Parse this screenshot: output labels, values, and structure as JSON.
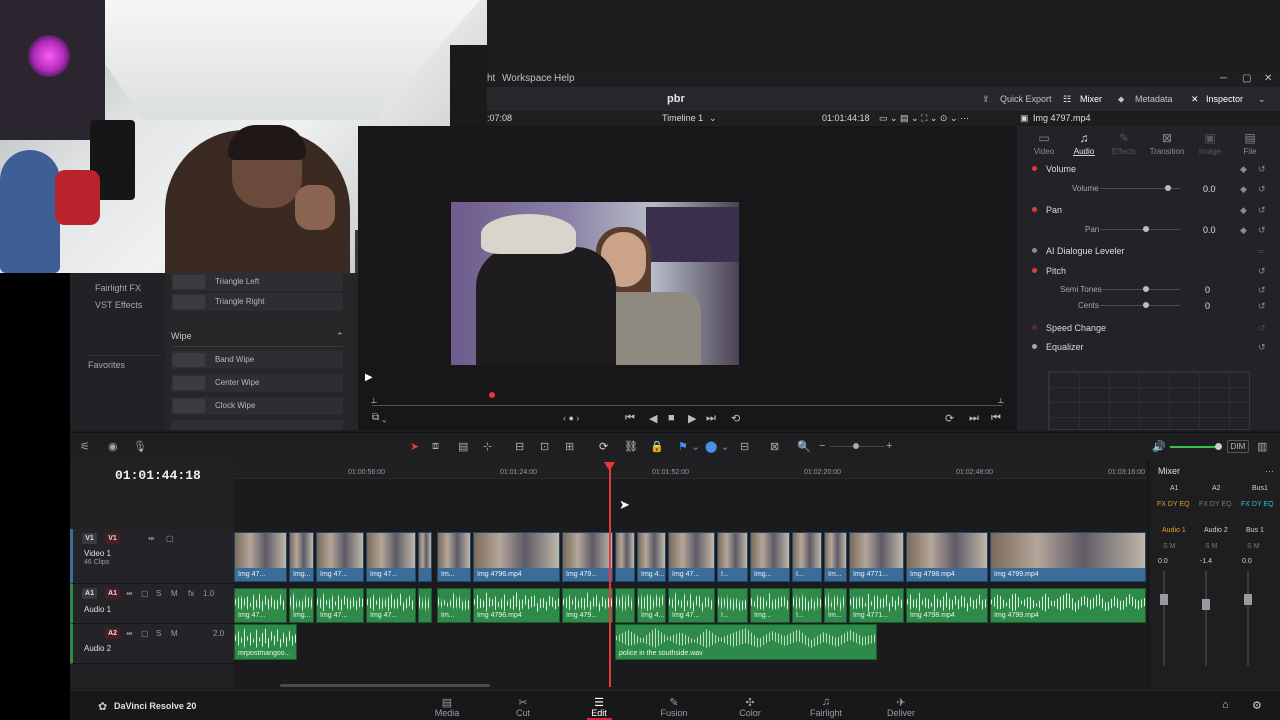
{
  "menubar": {
    "items": [
      "ht",
      "Workspace",
      "Help"
    ]
  },
  "header": {
    "project_title": "pbr",
    "quick_export": "Quick Export",
    "mixer": "Mixer",
    "metadata": "Metadata",
    "inspector": "Inspector",
    "clip_name": "Img 4797.mp4"
  },
  "viewer": {
    "timecode_left": ":07:08",
    "timeline_name": "Timeline 1",
    "timecode_right": "01:01:44:18"
  },
  "effects_library": {
    "categories": [
      "Fairlight FX",
      "VST Effects",
      "Favorites"
    ],
    "items_top": [
      "Triangle Left",
      "Triangle Right"
    ],
    "section": "Wipe",
    "wipe_items": [
      "Band Wipe",
      "Center Wipe",
      "Clock Wipe"
    ]
  },
  "inspector": {
    "tabs": [
      {
        "label": "Video",
        "icon": "video-icon",
        "state": "normal"
      },
      {
        "label": "Audio",
        "icon": "music-note-icon",
        "state": "active"
      },
      {
        "label": "Effects",
        "icon": "effects-icon",
        "state": "disabled"
      },
      {
        "label": "Transition",
        "icon": "transition-icon",
        "state": "normal"
      },
      {
        "label": "Image",
        "icon": "image-icon",
        "state": "disabled"
      },
      {
        "label": "File",
        "icon": "file-icon",
        "state": "normal"
      }
    ],
    "volume": {
      "title": "Volume",
      "param": "Volume",
      "value": "0.0"
    },
    "pan": {
      "title": "Pan",
      "param": "Pan",
      "value": "0.0"
    },
    "dialogue": {
      "title": "AI Dialogue Leveler"
    },
    "pitch": {
      "title": "Pitch",
      "semi_label": "Semi Tones",
      "semi_value": "0",
      "cents_label": "Cents",
      "cents_value": "0"
    },
    "speed_change": {
      "title": "Speed Change"
    },
    "equalizer": {
      "title": "Equalizer"
    },
    "accent_color": "#e23a3a"
  },
  "toolbar": {
    "dim_label": "DIM"
  },
  "timeline": {
    "timecode": "01:01:44:18",
    "ruler_ticks": [
      "01:00:56:00",
      "01:01:24:00",
      "01:01:52:00",
      "01:02:20:00",
      "01:02:48:00",
      "01:03:16:00"
    ],
    "tracks": {
      "video": {
        "id": "V1",
        "name": "Video 1",
        "sub": "46 Clips"
      },
      "audio1": {
        "id": "A1",
        "name": "Audio 1",
        "level": "1.0"
      },
      "audio2": {
        "id": "A2",
        "name": "Audio 2",
        "level": "2.0"
      }
    },
    "video_clips": [
      "Img 47...",
      "Img...",
      "Img 47...",
      "Img 47...",
      "Im...",
      "Img 4796.mp4",
      "Img 479...",
      "Img 4...",
      "Img 47...",
      "I...",
      "Img...",
      "I...",
      "Im...",
      "Img 4771...",
      "Img 4798.mp4",
      "Img 4799.mp4"
    ],
    "audio_clips": [
      "Img 47...",
      "Img...",
      "Img 47...",
      "Img 47...",
      "Im...",
      "Img 4796.mp4",
      "Img 479...",
      "Img 4...",
      "Img 47...",
      "I...",
      "Img...",
      "I...",
      "Im...",
      "Img 4771...",
      "Img 4798.mp4",
      "Img 4799.mp4"
    ],
    "audio2_clips": [
      "mrpostmangoo...",
      "police in the southside.wav"
    ],
    "colors": {
      "video": "#3c6d99",
      "audio": "#2e8a48",
      "playhead": "#e23a3a"
    }
  },
  "mixer": {
    "title": "Mixer",
    "columns": [
      "A1",
      "A2",
      "Bus1"
    ],
    "channels": [
      "Audio 1",
      "Audio 2",
      "Bus 1"
    ],
    "levels": [
      "0.0",
      "-1.4",
      "0.0"
    ]
  },
  "pagebar": {
    "brand": "DaVinci Resolve 20",
    "pages": [
      {
        "label": "Media",
        "icon": "media-icon"
      },
      {
        "label": "Cut",
        "icon": "cut-icon"
      },
      {
        "label": "Edit",
        "icon": "edit-icon",
        "active": true
      },
      {
        "label": "Fusion",
        "icon": "fusion-icon"
      },
      {
        "label": "Color",
        "icon": "color-icon"
      },
      {
        "label": "Fairlight",
        "icon": "fairlight-icon"
      },
      {
        "label": "Deliver",
        "icon": "deliver-icon"
      }
    ]
  }
}
